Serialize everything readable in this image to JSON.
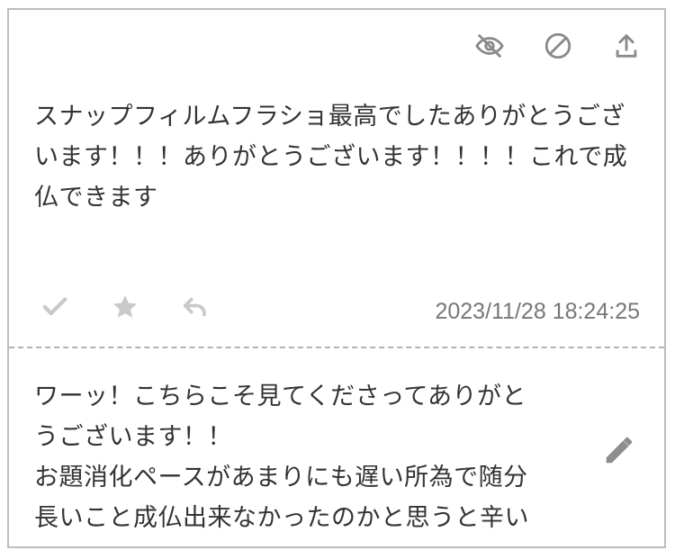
{
  "card": {
    "message": "スナップフィルムフラショ最高でしたありがとうございます！！！ありがとうございます！！！！これで成仏できます",
    "timestamp": "2023/11/28 18:24:25",
    "reply": "ワーッ！こちらこそ見てくださってありがと\nうございます！！\nお題消化ペースがあまりにも遅い所為で随分\n長いこと成仏出来なかったのかと思うと辛い"
  },
  "icons": {
    "top": [
      "eye-off-icon",
      "block-icon",
      "upload-icon"
    ],
    "bottom": [
      "check-icon",
      "star-icon",
      "reply-icon"
    ],
    "edit": "pencil-icon"
  },
  "colors": {
    "border": "#bdbdbd",
    "text": "#333333",
    "muted": "#8a8a8a",
    "lightIcon": "#c9c9c9",
    "timestamp": "#777777"
  }
}
